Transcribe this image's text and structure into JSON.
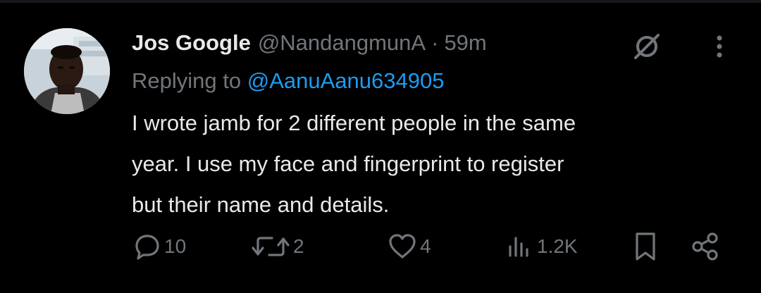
{
  "tweet": {
    "author": {
      "display_name": "Jos Google",
      "handle": "@NandangmunA"
    },
    "separator": "·",
    "timestamp": "59m",
    "replying_to": {
      "prefix": "Replying to ",
      "handle": "@AanuAanu634905"
    },
    "text": "I wrote jamb for 2 different people in the same\nyear. I use my face and fingerprint to register\nbut their name and details."
  },
  "actions": {
    "replies": "10",
    "reposts": "2",
    "likes": "4",
    "views": "1.2K"
  },
  "icons": {
    "grok": "grok-slash-icon",
    "more": "more-vertical-icon",
    "reply": "reply-bubble-icon",
    "repost": "repost-icon",
    "like": "heart-icon",
    "views": "bar-chart-icon",
    "bookmark": "bookmark-icon",
    "share": "share-icon"
  },
  "colors": {
    "background": "#000000",
    "primary_text": "#e7e9ea",
    "secondary_text": "#71767b",
    "link": "#1d9bf0"
  }
}
